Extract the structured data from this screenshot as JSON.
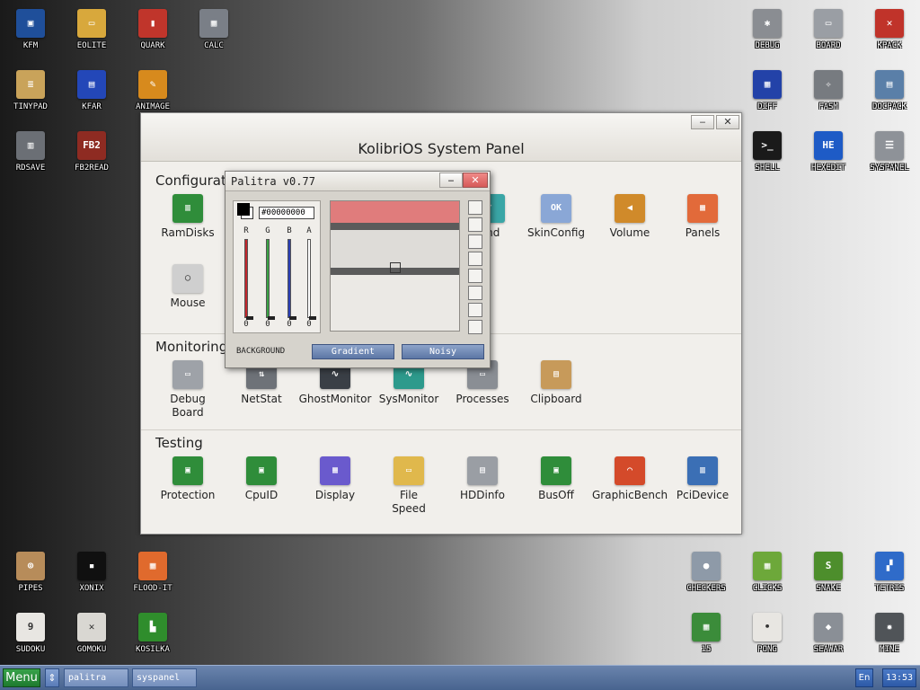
{
  "desktop": {
    "icons": [
      {
        "label": "KFM",
        "icon": "floppy-icon",
        "color": "#1f4f9a",
        "glyph": "▣"
      },
      {
        "label": "EOLITE",
        "icon": "folder-icon",
        "color": "#d8a83c",
        "glyph": "▭"
      },
      {
        "label": "QUARK",
        "icon": "book-icon",
        "color": "#c0352b",
        "glyph": "▮"
      },
      {
        "label": "CALC",
        "icon": "calculator-icon",
        "color": "#7a7f87",
        "glyph": "▦"
      },
      {
        "label": "TINYPAD",
        "icon": "notepad-icon",
        "color": "#c9a35a",
        "glyph": "≡"
      },
      {
        "label": "KFAR",
        "icon": "blue-panels-icon",
        "color": "#2347b8",
        "glyph": "▤"
      },
      {
        "label": "ANIMAGE",
        "icon": "pencil-icon",
        "color": "#d78a1d",
        "glyph": "✎"
      },
      {
        "label": "RDSAVE",
        "icon": "disk-save-icon",
        "color": "#6b6f75",
        "glyph": "▥"
      },
      {
        "label": "FB2READ",
        "icon": "fb2-book-icon",
        "color": "#8e2b22",
        "glyph": "FB2"
      },
      {
        "label": "DEBUG",
        "icon": "debug-window-icon",
        "color": "#8a8d92",
        "glyph": "✱"
      },
      {
        "label": "BOARD",
        "icon": "board-window-icon",
        "color": "#9a9ea4",
        "glyph": "▭"
      },
      {
        "label": "KPACK",
        "icon": "wrench-icon",
        "color": "#c0332a",
        "glyph": "✕"
      },
      {
        "label": "DIFF",
        "icon": "diff-grid-icon",
        "color": "#2342a8",
        "glyph": "▦"
      },
      {
        "label": "FASM",
        "icon": "fasm-icon",
        "color": "#777b80",
        "glyph": "✧"
      },
      {
        "label": "DOCPACK",
        "icon": "cabinet-icon",
        "color": "#5a7fa8",
        "glyph": "▤"
      },
      {
        "label": "SHELL",
        "icon": "terminal-icon",
        "color": "#1a1a1a",
        "glyph": ">_"
      },
      {
        "label": "HEXEDIT",
        "icon": "hexedit-icon",
        "color": "#1e5bc6",
        "glyph": "HE"
      },
      {
        "label": "SYSPANEL",
        "icon": "sliders-icon",
        "color": "#8e9298",
        "glyph": "☰"
      },
      {
        "label": "PIPES",
        "icon": "pipes-icon",
        "color": "#b78c5a",
        "glyph": "⊚"
      },
      {
        "label": "XONIX",
        "icon": "xonix-icon",
        "color": "#101010",
        "glyph": "▪"
      },
      {
        "label": "FLOOD-IT",
        "icon": "flood-it-icon",
        "color": "#e06a2d",
        "glyph": "▦"
      },
      {
        "label": "SUDOKU",
        "icon": "sudoku-icon",
        "color": "#e8e6e2",
        "glyph": "9"
      },
      {
        "label": "GOMOKU",
        "icon": "gomoku-icon",
        "color": "#d9d7d2",
        "glyph": "✕"
      },
      {
        "label": "KOSILKA",
        "icon": "lawnmower-icon",
        "color": "#2f8d2c",
        "glyph": "▙"
      },
      {
        "label": "CHECKERS",
        "icon": "checkers-icon",
        "color": "#8e9aa8",
        "glyph": "●"
      },
      {
        "label": "CLICKS",
        "icon": "clicks-icon",
        "color": "#6da83a",
        "glyph": "▦"
      },
      {
        "label": "SNAKE",
        "icon": "snake-icon",
        "color": "#4d8e2c",
        "glyph": "S"
      },
      {
        "label": "TETRIS",
        "icon": "tetris-icon",
        "color": "#2f6bc9",
        "glyph": "▞"
      },
      {
        "label": "15",
        "icon": "fifteen-icon",
        "color": "#3b8c3a",
        "glyph": "▦"
      },
      {
        "label": "PONG",
        "icon": "pong-icon",
        "color": "#e8e6e2",
        "glyph": "•"
      },
      {
        "label": "SEAWAR",
        "icon": "seawar-icon",
        "color": "#8a8f96",
        "glyph": "◆"
      },
      {
        "label": "MINE",
        "icon": "mine-icon",
        "color": "#505458",
        "glyph": "✹"
      }
    ]
  },
  "syspanel": {
    "title": "KolibriOS System Panel",
    "minimize": "‒",
    "close": "✕",
    "sections": [
      {
        "label": "Configuratio"
      },
      {
        "label": "Monitoring"
      },
      {
        "label": "Testing"
      }
    ],
    "items": [
      {
        "label": "RamDisks",
        "icon": "ramdisk-chip-icon",
        "color": "#2f8d3a",
        "glyph": "▥"
      },
      {
        "label": "Mouse",
        "icon": "mouse-icon",
        "color": "#cfcfcf",
        "glyph": "◯"
      },
      {
        "label": "und",
        "icon": "sound-icon",
        "color": "#3aa6a6",
        "glyph": "♪"
      },
      {
        "label": "SkinConfig",
        "icon": "skinconfig-icon",
        "color": "#8aa7d6",
        "glyph": "OK"
      },
      {
        "label": "Volume",
        "icon": "speaker-icon",
        "color": "#d08a2a",
        "glyph": "◀"
      },
      {
        "label": "Panels",
        "icon": "panels-icon",
        "color": "#e26a3a",
        "glyph": "▦"
      },
      {
        "label": "Debug\nBoard",
        "icon": "debug-board-icon",
        "color": "#9ea2a8",
        "glyph": "▭"
      },
      {
        "label": "NetStat",
        "icon": "netstat-icon",
        "color": "#6e7278",
        "glyph": "⇅"
      },
      {
        "label": "GhostMonitor",
        "icon": "ghostmonitor-icon",
        "color": "#3a3f46",
        "glyph": "∿"
      },
      {
        "label": "SysMonitor",
        "icon": "sysmonitor-icon",
        "color": "#2d9a8c",
        "glyph": "∿"
      },
      {
        "label": "Processes",
        "icon": "processes-icon",
        "color": "#8a8e94",
        "glyph": "▭"
      },
      {
        "label": "Clipboard",
        "icon": "clipboard-icon",
        "color": "#c79a5a",
        "glyph": "▤"
      },
      {
        "label": "Protection",
        "icon": "protection-chip-icon",
        "color": "#2f8d3a",
        "glyph": "▣"
      },
      {
        "label": "CpuID",
        "icon": "cpu-chip-icon",
        "color": "#2f8d3a",
        "glyph": "▣"
      },
      {
        "label": "Display",
        "icon": "display-icon",
        "color": "#6a5acd",
        "glyph": "▦"
      },
      {
        "label": "File\nSpeed",
        "icon": "file-speed-folder-icon",
        "color": "#e0b84c",
        "glyph": "▭"
      },
      {
        "label": "HDDinfo",
        "icon": "hdd-icon",
        "color": "#9a9ea4",
        "glyph": "▤"
      },
      {
        "label": "BusOff",
        "icon": "busoff-chip-icon",
        "color": "#2f8d3a",
        "glyph": "▣"
      },
      {
        "label": "GraphicBench",
        "icon": "gauge-icon",
        "color": "#d44a2a",
        "glyph": "◠"
      },
      {
        "label": "PciDevice",
        "icon": "pci-card-icon",
        "color": "#3b6fb5",
        "glyph": "▥"
      }
    ]
  },
  "palitra": {
    "title": "Palitra v0.77",
    "minimize": "‒",
    "close": "✕",
    "hex": "#00000000",
    "channels": [
      {
        "label": "R",
        "value": "0",
        "color": "#c2272d"
      },
      {
        "label": "G",
        "value": "0",
        "color": "#3aa244"
      },
      {
        "label": "B",
        "value": "0",
        "color": "#2a3fb5"
      },
      {
        "label": "A",
        "value": "0",
        "color": "#ffffff"
      }
    ],
    "background_label": "BACKGROUND",
    "gradient_btn": "Gradient",
    "noisy_btn": "Noisy",
    "fg_color": "#000000",
    "bg_color": "#ffffff"
  },
  "taskbar": {
    "menu": "Menu",
    "switch_icon": "⇕",
    "tasks": [
      {
        "label": "palitra"
      },
      {
        "label": "syspanel"
      }
    ],
    "lang": "En",
    "clock": "13:53"
  }
}
